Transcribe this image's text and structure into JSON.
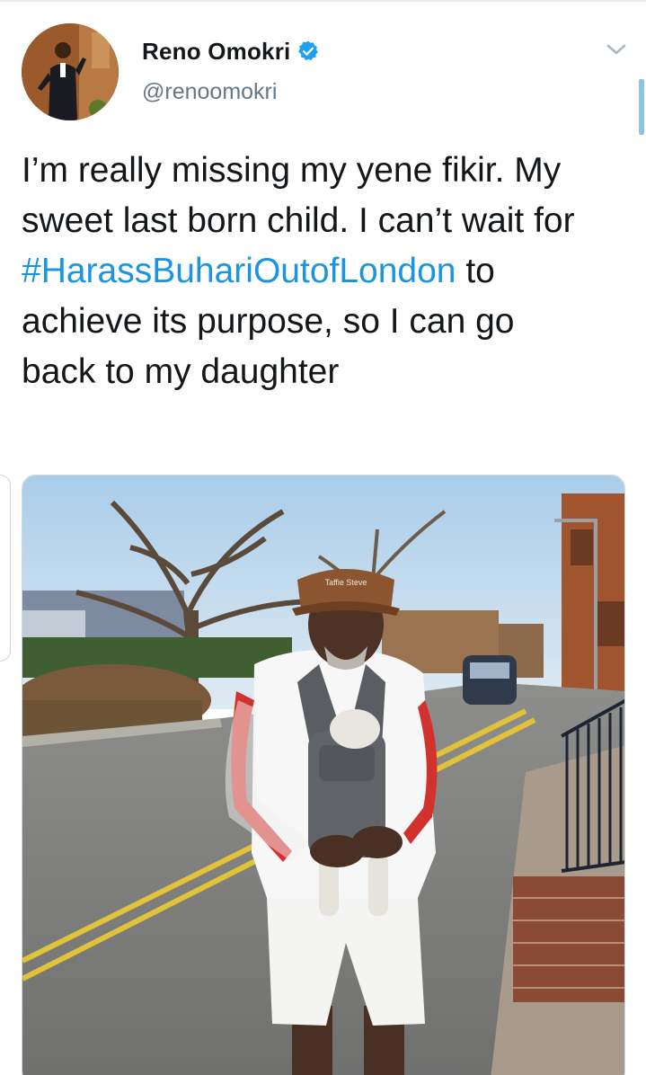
{
  "tweet": {
    "author": {
      "display_name": "Reno Omokri",
      "handle": "@renoomokri",
      "verified": true,
      "avatar_icon": "profile-photo"
    },
    "text_before": "I’m really missing my yene fikir. My sweet last born child. I can’t wait for ",
    "hashtag": "#HarassBuhariOutofLondon",
    "text_after": " to achieve its purpose, so I can go back to my daughter",
    "media": {
      "type": "photo",
      "cap_text": "Taffie Steve"
    },
    "menu_icon": "chevron-down-icon",
    "colors": {
      "link": "#1b95e0",
      "verified": "#1da1f2",
      "text": "#14171a",
      "secondary": "#657786"
    }
  }
}
